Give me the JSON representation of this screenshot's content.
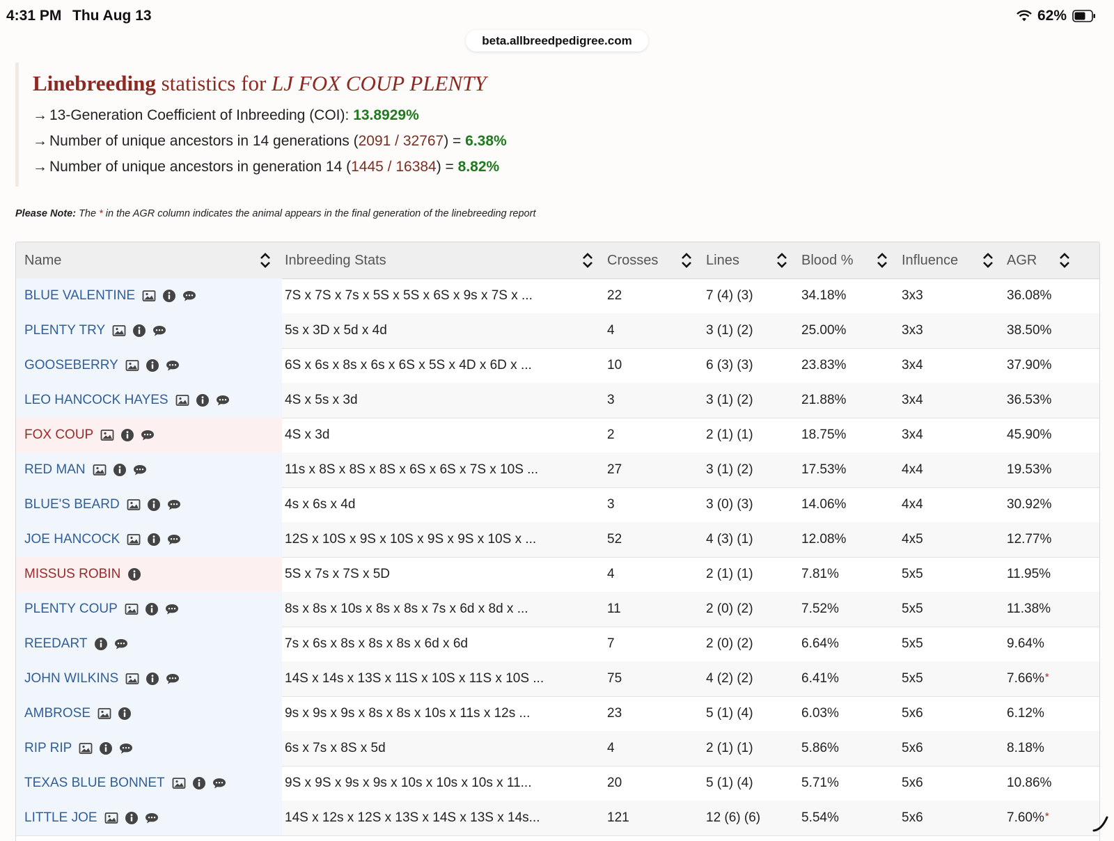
{
  "status_bar": {
    "time": "4:31 PM",
    "date": "Thu Aug 13",
    "battery": "62%"
  },
  "browser": {
    "url": "beta.allbreedpedigree.com"
  },
  "summary": {
    "title_strong": "Linebreeding",
    "title_mid": " statistics for ",
    "horse_name": "LJ FOX COUP PLENTY",
    "lines": [
      {
        "text": "13-Generation Coefficient of Inbreeding (COI): ",
        "count": "",
        "ratio_suffix": "",
        "percent": "13.8929%"
      },
      {
        "text": "Number of unique ancestors in 14 generations (",
        "count": "2091 / 32767",
        "ratio_suffix": ") = ",
        "percent": "6.38%"
      },
      {
        "text": "Number of unique ancestors in generation 14 (",
        "count": "1445 / 16384",
        "ratio_suffix": ") = ",
        "percent": "8.82%"
      }
    ]
  },
  "note": {
    "label": "Please Note:",
    "pre": " The ",
    "star": "*",
    "post": " in the AGR column indicates the animal appears in the final generation of the linebreeding report"
  },
  "table": {
    "headers": [
      "Name",
      "Inbreeding Stats",
      "Crosses",
      "Lines",
      "Blood %",
      "Influence",
      "AGR"
    ],
    "colors": {
      "stallion": "#2f5e9a",
      "mare": "#9b2a2a"
    },
    "rows": [
      {
        "name": "BLUE VALENTINE",
        "sex": "stallion",
        "photo": true,
        "comment": true,
        "stats": "7S x 7S x 7s x 5S x 5S x 6S x 9s x 7S x ...",
        "crosses": "22",
        "lines": "7 (4) (3)",
        "blood": "34.18%",
        "influence": "3x3",
        "agr": "36.08%",
        "final": false
      },
      {
        "name": "PLENTY TRY",
        "sex": "stallion",
        "photo": true,
        "comment": true,
        "stats": "5s x 3D x 5d x 4d",
        "crosses": "4",
        "lines": "3 (1) (2)",
        "blood": "25.00%",
        "influence": "3x3",
        "agr": "38.50%",
        "final": false
      },
      {
        "name": "GOOSEBERRY",
        "sex": "stallion",
        "photo": true,
        "comment": true,
        "stats": "6S x 6s x 8s x 6s x 6S x 5S x 4D x 6D x ...",
        "crosses": "10",
        "lines": "6 (3) (3)",
        "blood": "23.83%",
        "influence": "3x4",
        "agr": "37.90%",
        "final": false
      },
      {
        "name": "LEO HANCOCK HAYES",
        "sex": "stallion",
        "photo": true,
        "comment": true,
        "stats": "4S x 5s x 3d",
        "crosses": "3",
        "lines": "3 (1) (2)",
        "blood": "21.88%",
        "influence": "3x4",
        "agr": "36.53%",
        "final": false
      },
      {
        "name": "FOX COUP",
        "sex": "mare",
        "photo": true,
        "comment": true,
        "stats": "4S x 3d",
        "crosses": "2",
        "lines": "2 (1) (1)",
        "blood": "18.75%",
        "influence": "3x4",
        "agr": "45.90%",
        "final": false
      },
      {
        "name": "RED MAN",
        "sex": "stallion",
        "photo": true,
        "comment": true,
        "stats": "11s x 8S x 8S x 8S x 6S x 6S x 7S x 10S ...",
        "crosses": "27",
        "lines": "3 (1) (2)",
        "blood": "17.53%",
        "influence": "4x4",
        "agr": "19.53%",
        "final": false
      },
      {
        "name": "BLUE'S BEARD",
        "sex": "stallion",
        "photo": true,
        "comment": true,
        "stats": "4s x 6s x 4d",
        "crosses": "3",
        "lines": "3 (0) (3)",
        "blood": "14.06%",
        "influence": "4x4",
        "agr": "30.92%",
        "final": false
      },
      {
        "name": "JOE HANCOCK",
        "sex": "stallion",
        "photo": true,
        "comment": true,
        "stats": "12S x 10S x 9S x 10S x 9S x 9S x 10S x ...",
        "crosses": "52",
        "lines": "4 (3) (1)",
        "blood": "12.08%",
        "influence": "4x5",
        "agr": "12.77%",
        "final": false
      },
      {
        "name": "MISSUS ROBIN",
        "sex": "mare",
        "photo": false,
        "comment": false,
        "stats": "5S x 7s x 7S x 5D",
        "crosses": "4",
        "lines": "2 (1) (1)",
        "blood": "7.81%",
        "influence": "5x5",
        "agr": "11.95%",
        "final": false
      },
      {
        "name": "PLENTY COUP",
        "sex": "stallion",
        "photo": true,
        "comment": true,
        "stats": "8s x 8s x 10s x 8s x 8s x 7s x 6d x 8d x ...",
        "crosses": "11",
        "lines": "2 (0) (2)",
        "blood": "7.52%",
        "influence": "5x5",
        "agr": "11.38%",
        "final": false
      },
      {
        "name": "REEDART",
        "sex": "stallion",
        "photo": false,
        "comment": true,
        "stats": "7s x 6s x 8s x 8s x 8s x 6d x 6d",
        "crosses": "7",
        "lines": "2 (0) (2)",
        "blood": "6.64%",
        "influence": "5x5",
        "agr": "9.64%",
        "final": false
      },
      {
        "name": "JOHN WILKINS",
        "sex": "stallion",
        "photo": true,
        "comment": true,
        "stats": "14S x 14s x 13S x 11S x 10S x 11S x 10S ...",
        "crosses": "75",
        "lines": "4 (2) (2)",
        "blood": "6.41%",
        "influence": "5x5",
        "agr": "7.66%",
        "final": true
      },
      {
        "name": "AMBROSE",
        "sex": "stallion",
        "photo": true,
        "comment": false,
        "stats": "9s x 9s x 9s x 8s x 8s x 10s x 11s x 12s ...",
        "crosses": "23",
        "lines": "5 (1) (4)",
        "blood": "6.03%",
        "influence": "5x6",
        "agr": "6.12%",
        "final": false
      },
      {
        "name": "RIP RIP",
        "sex": "stallion",
        "photo": true,
        "comment": true,
        "stats": "6s x 7s x 8S x 5d",
        "crosses": "4",
        "lines": "2 (1) (1)",
        "blood": "5.86%",
        "influence": "5x6",
        "agr": "8.18%",
        "final": false
      },
      {
        "name": "TEXAS BLUE BONNET",
        "sex": "stallion",
        "photo": true,
        "comment": true,
        "stats": "9S x 9S x 9s x 9s x 10s x 10s x 10s x 11...",
        "crosses": "20",
        "lines": "5 (1) (4)",
        "blood": "5.71%",
        "influence": "5x6",
        "agr": "10.86%",
        "final": false
      },
      {
        "name": "LITTLE JOE",
        "sex": "stallion",
        "photo": true,
        "comment": true,
        "stats": "14S x 12s x 12S x 13S x 14S x 13S x 14s...",
        "crosses": "121",
        "lines": "12 (6) (6)",
        "blood": "5.54%",
        "influence": "5x6",
        "agr": "7.60%",
        "final": true
      }
    ]
  }
}
